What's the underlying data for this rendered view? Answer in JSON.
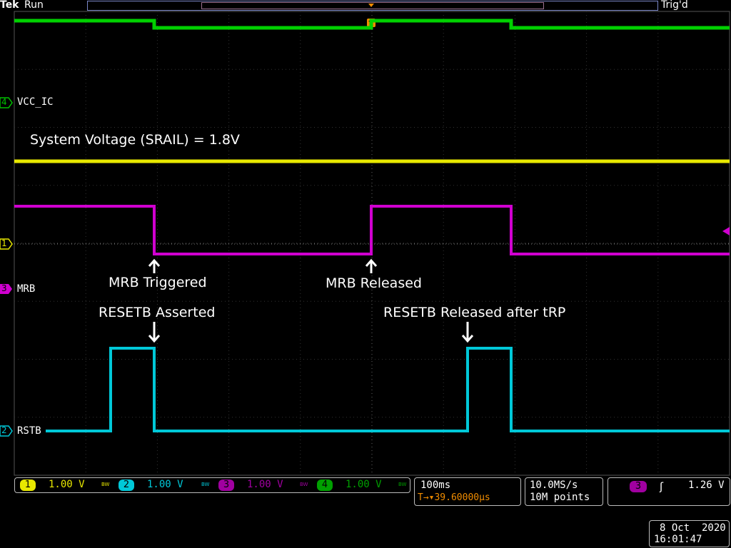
{
  "header": {
    "brand": "Tek",
    "run_state": "Run",
    "trigger_status": "Trig'd",
    "trigger_marker": "T"
  },
  "channels": [
    {
      "number": "1",
      "label": "",
      "color": "#e8e800"
    },
    {
      "number": "2",
      "label": "RSTB",
      "color": "#00c8d8"
    },
    {
      "number": "3",
      "label": "MRB",
      "color": "#d000d0"
    },
    {
      "number": "4",
      "label": "VCC_IC",
      "color": "#00c000"
    }
  ],
  "annotations": {
    "system_voltage": "System Voltage (SRAIL) = 1.8V",
    "mrb_triggered": "MRB Triggered",
    "mrb_released": "MRB Released",
    "resetb_asserted": "RESETB Asserted",
    "resetb_released": "RESETB Released after tRP"
  },
  "scales": [
    {
      "channel": "1",
      "value": "1.00 V",
      "bw": "BW",
      "color": "#e8e800"
    },
    {
      "channel": "2",
      "value": "1.00 V",
      "bw": "BW",
      "color": "#00c8d8"
    },
    {
      "channel": "3",
      "value": "1.00 V",
      "bw": "BW",
      "color": "#d000d0"
    },
    {
      "channel": "4",
      "value": "1.00 V",
      "bw": "BW",
      "color": "#00c000"
    }
  ],
  "horizontal": {
    "timebase": "100ms",
    "trigger_position": "T→▾39.60000µs"
  },
  "acquisition": {
    "sample_rate": "10.0MS/s",
    "record_length": "10M points"
  },
  "trigger": {
    "source": "3",
    "slope_icon": "rising-edge-icon",
    "level": "1.26 V"
  },
  "datetime": {
    "date": "8 Oct  2020",
    "time": "16:01:47"
  }
}
